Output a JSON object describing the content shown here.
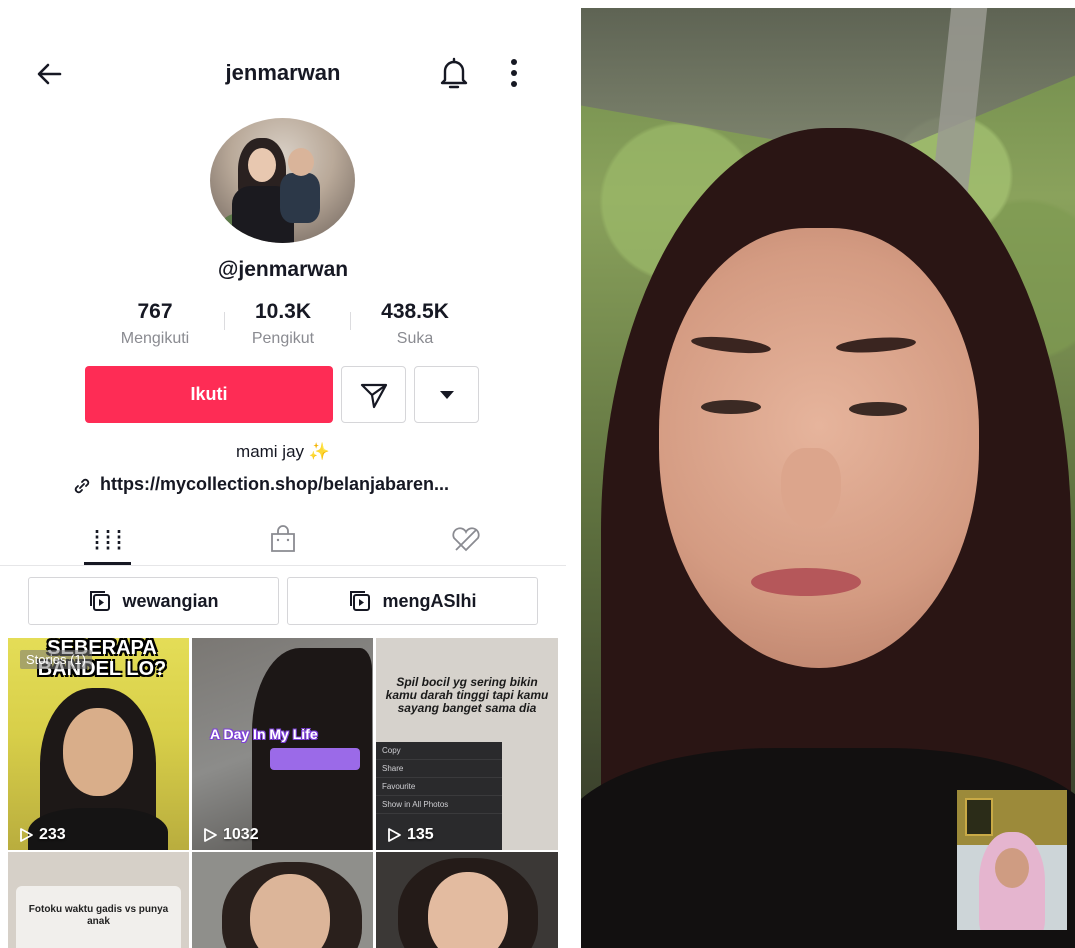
{
  "profile": {
    "title": "jenmarwan",
    "handle": "@jenmarwan",
    "stats": [
      {
        "value": "767",
        "label": "Mengikuti"
      },
      {
        "value": "10.3K",
        "label": "Pengikut"
      },
      {
        "value": "438.5K",
        "label": "Suka"
      }
    ],
    "follow_label": "Ikuti",
    "bio": "mami jay",
    "bio_emoji": "✨",
    "link": "https://mycollection.shop/belanjabaren...",
    "playlists": [
      "wewangian",
      "mengASIhi"
    ],
    "accent_color": "#fe2c55"
  },
  "videos": [
    {
      "badge": "Stories (1)",
      "caption": "SEBERAPA BANDEL LO?",
      "views": "233"
    },
    {
      "caption": "A Day In My Life",
      "views": "1032"
    },
    {
      "caption": "Spil bocil yg sering bikin kamu darah tinggi tapi kamu sayang banget sama dia",
      "menu": [
        "Copy",
        "Share",
        "Favourite",
        "Show in All Photos"
      ],
      "views": "135"
    },
    {
      "caption": "Fotoku waktu gadis vs punya anak"
    },
    {},
    {}
  ]
}
